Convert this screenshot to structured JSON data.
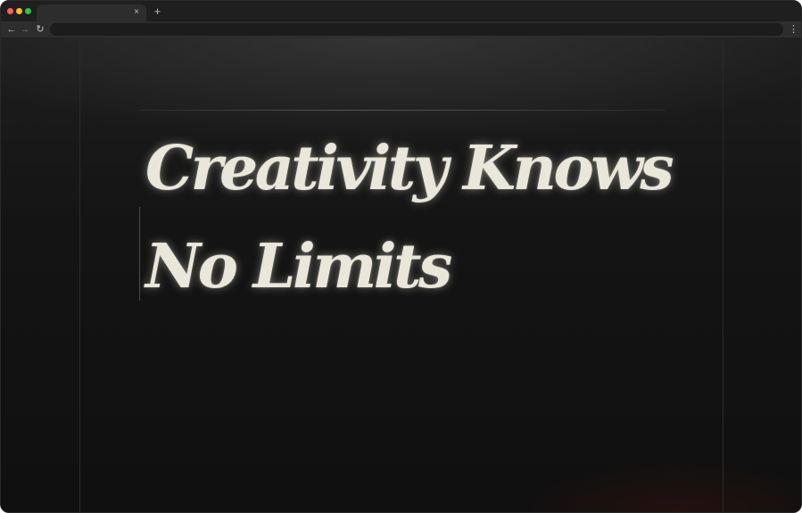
{
  "browser": {
    "tab": {
      "title": "",
      "close_glyph": "×"
    },
    "new_tab_glyph": "+",
    "toolbar": {
      "back_glyph": "←",
      "forward_glyph": "→",
      "reload_glyph": "↻",
      "address": "",
      "menu_glyph": "⋮"
    },
    "traffic_lights": {
      "close": "#ff5f57",
      "minimize": "#febc2e",
      "zoom": "#28c840"
    }
  },
  "hero": {
    "headline_line_1": "Creativity Knows",
    "headline_line_2": "No Limits",
    "text_color": "#e9e6da",
    "background_color": "#121212"
  }
}
